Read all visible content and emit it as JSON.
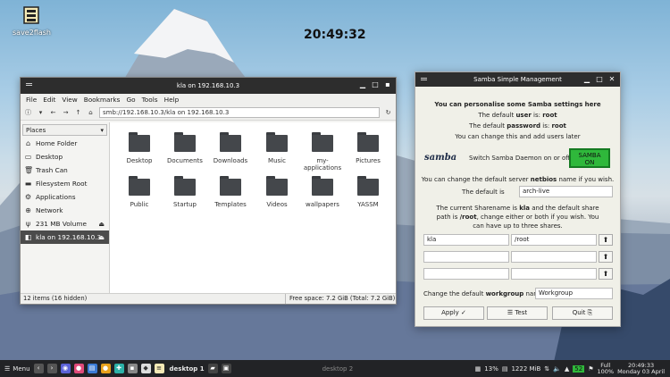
{
  "desktop": {
    "icon_label": "save2flash",
    "clock": "20:49:32"
  },
  "file_manager": {
    "title": "kla on 192.168.10.3",
    "menu": [
      "File",
      "Edit",
      "View",
      "Bookmarks",
      "Go",
      "Tools",
      "Help"
    ],
    "path": "smb://192.168.10.3/kla on 192.168.10.3",
    "places_label": "Places",
    "places": [
      {
        "label": "Home Folder",
        "icon": "home-icon"
      },
      {
        "label": "Desktop",
        "icon": "desktop-icon"
      },
      {
        "label": "Trash Can",
        "icon": "trash-icon"
      },
      {
        "label": "Filesystem Root",
        "icon": "drive-icon"
      },
      {
        "label": "Applications",
        "icon": "applications-icon"
      },
      {
        "label": "Network",
        "icon": "network-icon"
      },
      {
        "label": "231 MB Volume",
        "icon": "usb-icon"
      },
      {
        "label": "kla on 192.168.10.3",
        "icon": "network-share-icon"
      }
    ],
    "files": [
      "Desktop",
      "Documents",
      "Downloads",
      "Music",
      "my-applications",
      "Pictures",
      "Public",
      "Startup",
      "Templates",
      "Videos",
      "wallpapers",
      "YASSM"
    ],
    "status_left": "12 items (16 hidden)",
    "status_right": "Free space: 7.2 GiB (Total: 7.2 GiB)"
  },
  "samba": {
    "title": "Samba Simple Management",
    "heading": "You can personalise some Samba settings here",
    "default_user_prefix": "The default ",
    "default_user_key": "user",
    "default_user_mid": " is: ",
    "default_user_value": "root",
    "default_pass_prefix": "The default ",
    "default_pass_key": "password",
    "default_pass_mid": " is: ",
    "default_pass_value": "root",
    "change_note": "You can change this and add users later",
    "logo_text": "samba",
    "daemon_text": "Switch Samba Daemon on or off.",
    "samba_on_line1": "SAMBA",
    "samba_on_line2": "ON",
    "netbios_prefix": "You can change the default server ",
    "netbios_key": "netbios",
    "netbios_suffix": " name if you wish.",
    "default_is_label": "The default is",
    "netbios_value": "arch-live",
    "share_line1_prefix": "The current Sharename is ",
    "share_line1_key": "kla",
    "share_line1_suffix": " and the default share",
    "share_line2_prefix": "path is ",
    "share_line2_key": "/root",
    "share_line2_suffix": ", change either or both if you wish. You",
    "share_line3": "can have up to three shares.",
    "shares": [
      {
        "name": "kla",
        "path": "/root"
      },
      {
        "name": "",
        "path": ""
      },
      {
        "name": "",
        "path": ""
      }
    ],
    "workgroup_prefix": "Change the default ",
    "workgroup_key": "workgroup",
    "workgroup_suffix": " name",
    "workgroup_value": "Workgroup",
    "apply_label": "Apply ✓",
    "test_label": "☰ Test",
    "quit_label": "Quit ⎘"
  },
  "taskbar": {
    "menu_label": "Menu",
    "workspace1": "desktop 1",
    "workspace2": "desktop 2",
    "cpu": "13%",
    "memory": "1222 MiB",
    "battery": "52",
    "power": "Full",
    "power2": "100%",
    "time": "20:49:33",
    "date": "Monday 03 April"
  },
  "colors": {
    "samba_on": "#2fb83b",
    "titlebar": "#2d2d2d",
    "taskbar": "#222326"
  }
}
